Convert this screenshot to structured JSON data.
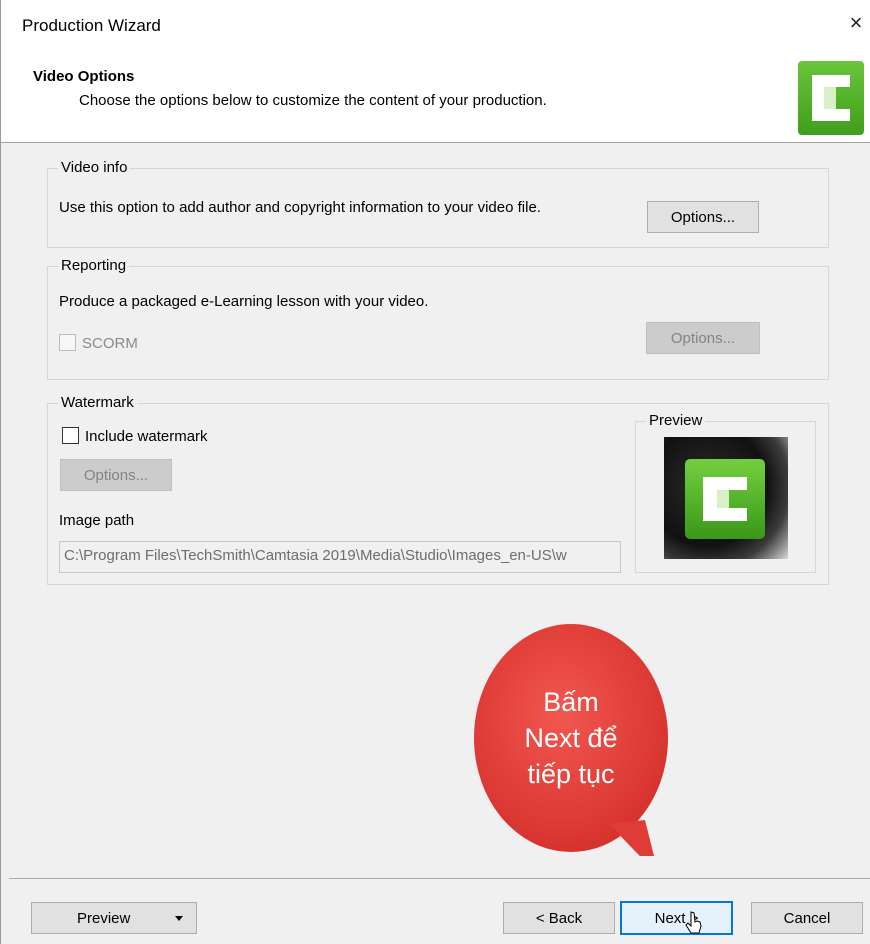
{
  "window": {
    "title": "Production Wizard",
    "close_glyph": "×"
  },
  "header": {
    "title": "Video Options",
    "subtitle": "Choose the options below to customize the content of your production.",
    "logo_icon": "camtasia-logo-icon"
  },
  "video_info": {
    "label": "Video info",
    "description": "Use this option to add author and copyright information to your video file.",
    "options_label": "Options..."
  },
  "reporting": {
    "label": "Reporting",
    "description": "Produce a packaged e-Learning lesson with your video.",
    "scorm_label": "SCORM",
    "scorm_checked": false,
    "options_label": "Options..."
  },
  "watermark": {
    "label": "Watermark",
    "include_label": "Include watermark",
    "include_checked": false,
    "options_label": "Options...",
    "image_path_label": "Image path",
    "image_path_value": "C:\\Program Files\\TechSmith\\Camtasia 2019\\Media\\Studio\\Images_en-US\\w",
    "preview_label": "Preview"
  },
  "callout": {
    "text_line1": "Bấm",
    "text_line2": "Next để",
    "text_line3": "tiếp tục",
    "color": "#e8413c"
  },
  "footer": {
    "preview_label": "Preview",
    "back_label": "< Back",
    "next_label": "Next >",
    "cancel_label": "Cancel"
  },
  "colors": {
    "accent": "#0078d7",
    "brand_green": "#4fae28"
  }
}
